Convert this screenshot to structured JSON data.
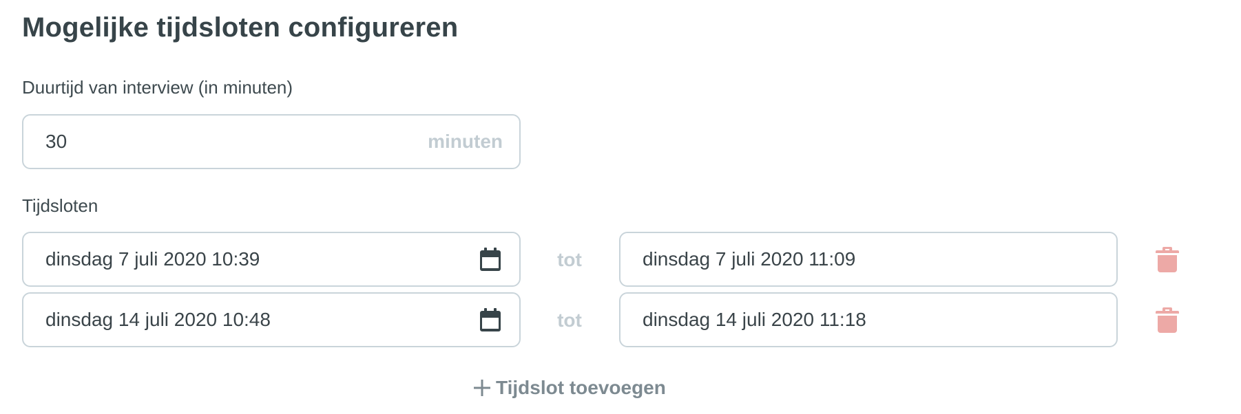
{
  "title": "Mogelijke tijdsloten configureren",
  "duration": {
    "label": "Duurtijd van interview (in minuten)",
    "value": "30",
    "suffix": "minuten"
  },
  "timeslots": {
    "label": "Tijdsloten",
    "separator": "tot",
    "rows": [
      {
        "start": "dinsdag 7 juli 2020 10:39",
        "end": "dinsdag 7 juli 2020 11:09"
      },
      {
        "start": "dinsdag 14 juli 2020 10:48",
        "end": "dinsdag 14 juli 2020 11:18"
      }
    ]
  },
  "add_button": {
    "label": "Tijdslot toevoegen"
  },
  "icons": {
    "calendar": "calendar-icon",
    "trash": "trash-icon",
    "plus": "plus-icon"
  },
  "colors": {
    "text": "#3a4449",
    "border": "#c9d4da",
    "muted": "#c2ccd2",
    "trash": "#eda9a6",
    "add_button": "#7d8a91"
  }
}
